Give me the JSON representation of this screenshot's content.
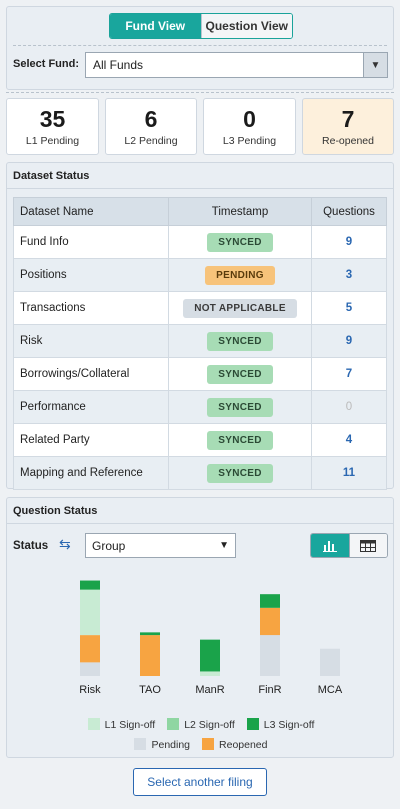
{
  "view_toggle": {
    "fund_view": "Fund View",
    "question_view": "Question View"
  },
  "fund_select": {
    "label": "Select Fund:",
    "value": "All Funds"
  },
  "summary": [
    {
      "count": "35",
      "label": "L1 Pending"
    },
    {
      "count": "6",
      "label": "L2 Pending"
    },
    {
      "count": "0",
      "label": "L3 Pending"
    },
    {
      "count": "7",
      "label": "Re-opened"
    }
  ],
  "dataset_status": {
    "title": "Dataset Status",
    "headers": [
      "Dataset Name",
      "Timestamp",
      "Questions"
    ],
    "rows": [
      {
        "name": "Fund Info",
        "status": "SYNCED",
        "questions": "9"
      },
      {
        "name": "Positions",
        "status": "PENDING",
        "questions": "3"
      },
      {
        "name": "Transactions",
        "status": "NOT APPLICABLE",
        "questions": "5"
      },
      {
        "name": "Risk",
        "status": "SYNCED",
        "questions": "9"
      },
      {
        "name": "Borrowings/Collateral",
        "status": "SYNCED",
        "questions": "7"
      },
      {
        "name": "Performance",
        "status": "SYNCED",
        "questions": "0"
      },
      {
        "name": "Related Party",
        "status": "SYNCED",
        "questions": "4"
      },
      {
        "name": "Mapping and Reference",
        "status": "SYNCED",
        "questions": "11"
      }
    ]
  },
  "question_status": {
    "title": "Question Status",
    "status_label": "Status",
    "group_value": "Group"
  },
  "chart_data": {
    "type": "bar",
    "stacked": true,
    "categories": [
      "Risk",
      "TAO",
      "ManR",
      "FinR",
      "MCA"
    ],
    "series": [
      {
        "name": "Pending",
        "color": "#d6dde4",
        "values": [
          1.5,
          0,
          0,
          4.5,
          3
        ]
      },
      {
        "name": "Reopened",
        "color": "#f7a441",
        "values": [
          3,
          4.5,
          0,
          3,
          0
        ]
      },
      {
        "name": "L1 Sign-off",
        "color": "#c8ebd3",
        "values": [
          5,
          0,
          0.5,
          0,
          0
        ]
      },
      {
        "name": "L2 Sign-off",
        "color": "#8fd6a2",
        "values": [
          0,
          0,
          0,
          0,
          0
        ]
      },
      {
        "name": "L3 Sign-off",
        "color": "#1aa34a",
        "values": [
          1,
          0.3,
          3.5,
          1.5,
          0
        ]
      }
    ],
    "legend_rows": [
      [
        "L1 Sign-off",
        "L2 Sign-off",
        "L3 Sign-off"
      ],
      [
        "Pending",
        "Reopened"
      ]
    ],
    "ylim": [
      0,
      11
    ]
  },
  "footer": {
    "button": "Select another filing"
  }
}
